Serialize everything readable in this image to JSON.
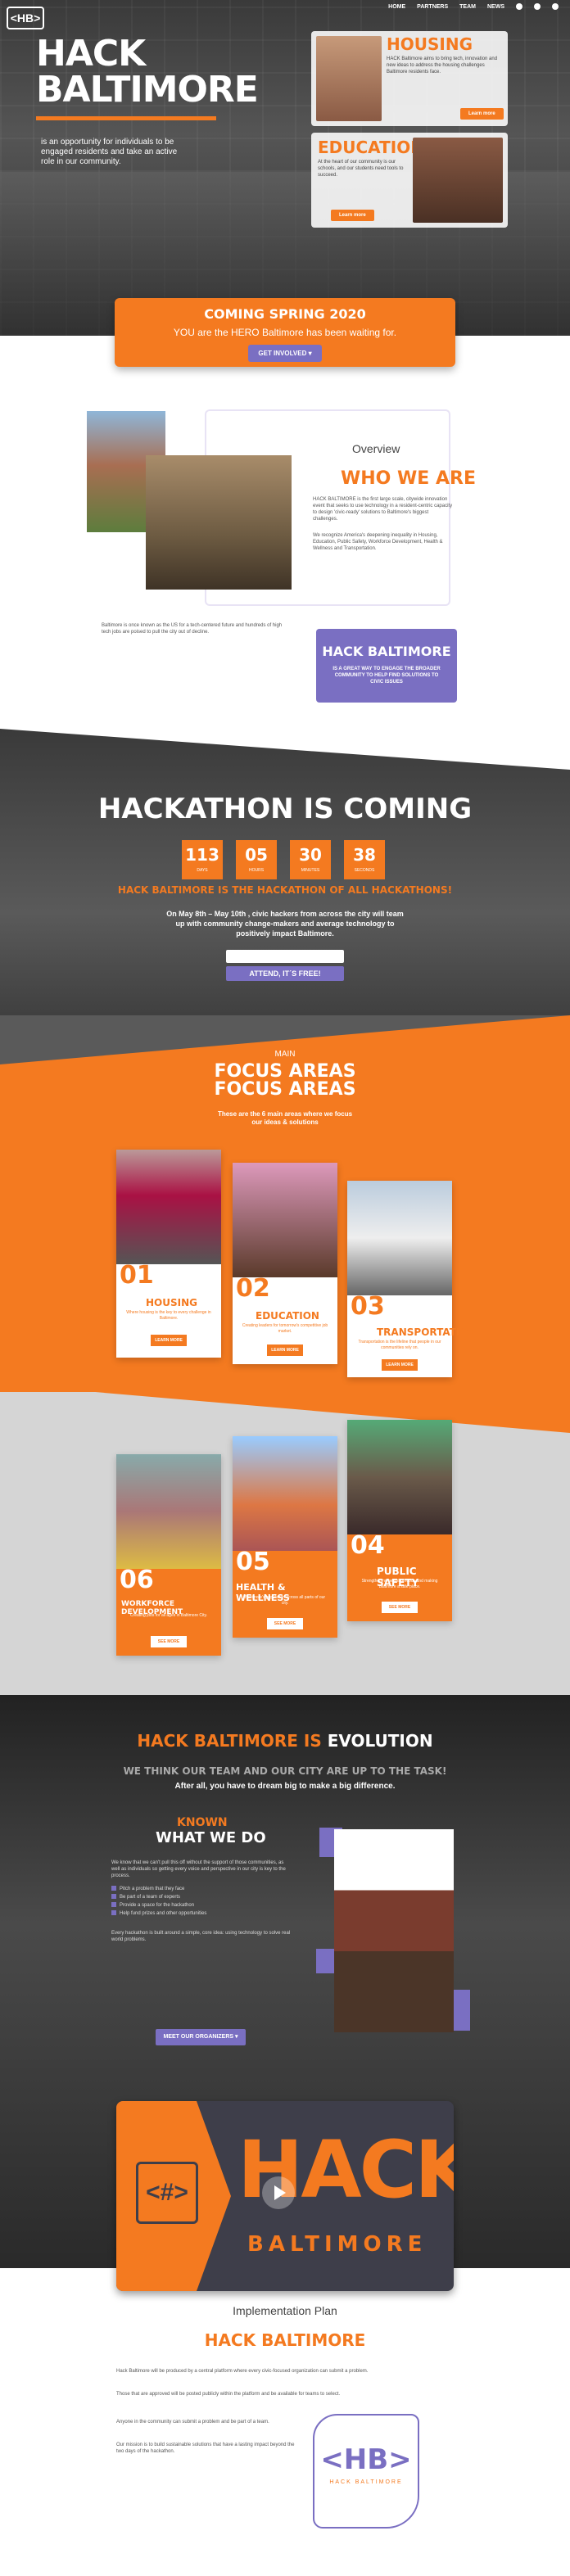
{
  "nav": {
    "logo": "<HB>",
    "items": [
      "HOME",
      "PARTNERS",
      "TEAM",
      "NEWS"
    ]
  },
  "hero": {
    "title1": "HACK",
    "title2": "BALTIMORE",
    "subtitle": "is an opportunity for individuals to be engaged residents and take an active role in our community."
  },
  "housing": {
    "title": "HOUSING",
    "text": "HACK Baltimore aims to bring tech, innovation and new ideas to address the housing challenges Baltimore residents face.",
    "btn": "Learn more"
  },
  "education": {
    "title": "EDUCATION",
    "text": "At the heart of our community is our schools, and our students need tools to succeed.",
    "btn": "Learn more"
  },
  "banner": {
    "title": "COMING SPRING 2020",
    "subtitle": "YOU are the HERO Baltimore has been waiting for.",
    "btn": "GET INVOLVED"
  },
  "overview": {
    "label": "Overview",
    "title": "WHO WE ARE",
    "p1": "HACK BALTIMORE is the first large scale, citywide innovation event that seeks to use technology in a resident-centric capacity to design 'civic-ready' solutions to Baltimore's biggest challenges.",
    "p2": "We recognize America's deepening inequality in Housing, Education, Public Safety, Workforce Development, Health & Wellness and Transportation.",
    "p3": "Baltimore is once known as the US for a tech-centered future and hundreds of high tech jobs are poised to pull the city out of decline.",
    "box_title": "HACK BALTIMORE",
    "box_text": "IS A GREAT WAY TO ENGAGE THE BROADER COMMUNITY TO HELP FIND SOLUTIONS TO CIVIC ISSUES"
  },
  "hackathon": {
    "title": "HACKATHON IS COMING",
    "countdown": [
      {
        "n": "113",
        "l": "days"
      },
      {
        "n": "05",
        "l": "hours"
      },
      {
        "n": "30",
        "l": "minutes"
      },
      {
        "n": "38",
        "l": "seconds"
      }
    ],
    "subtitle": "HACK BALTIMORE IS THE HACKATHON OF ALL HACKATHONS!",
    "desc": "On May 8th – May 10th , civic hackers from across the city will team up with community change-makers and average technology to positively impact Baltimore.",
    "btn": "ATTEND, IT´S FREE!"
  },
  "focus": {
    "label": "MAIN",
    "title1": "FOCUS AREAS",
    "title2": "FOCUS AREAS",
    "sub": "These are the 6 main areas where we focus our ideas & solutions",
    "cards": [
      {
        "num": "01",
        "name": "HOUSING",
        "desc": "Where housing is the key to every challenge in Baltimore.",
        "btn": "LEARN MORE"
      },
      {
        "num": "02",
        "name": "EDUCATION",
        "desc": "Creating leaders for tomorrow's competitive job market.",
        "btn": "LEARN MORE"
      },
      {
        "num": "03",
        "name": "TRANSPORTATION",
        "desc": "Transportation is the lifeline that people in our communities rely on.",
        "btn": "LEARN MORE"
      },
      {
        "num": "06",
        "name": "WORKFORCE DEVELOPMENT",
        "desc": "Creating jobs for all ages in Baltimore City.",
        "btn": "SEE MORE"
      },
      {
        "num": "05",
        "name": "HEALTH & WELLNESS",
        "desc": "Baltimore's population across all parts of our city.",
        "btn": "SEE MORE"
      },
      {
        "num": "04",
        "name": "PUBLIC SAFETY",
        "desc": "Strengthening neighborhoods and making Baltimore a safe place.",
        "btn": "SEE MORE"
      }
    ]
  },
  "evolution": {
    "title_o": "HACK BALTIMORE IS",
    "title_w": " EVOLUTION",
    "s1": "WE THINK OUR TEAM AND OUR CITY ARE UP TO THE TASK!",
    "s2": "After all, you have to dream big to make a big difference.",
    "known": "KNOWN",
    "wwd": "WHAT WE DO",
    "p": "We know that we can't pull this off without the support of those communities, as well as individuals so getting every voice and perspective in our city is key to the process.",
    "list": [
      "Pitch a problem that they face",
      "Be part of a team of experts",
      "Provide a space for the hackathon",
      "Help fund prizes and other opportunities"
    ],
    "p2": "Every hackathon is built around a simple, core idea: using technology to solve real world problems.",
    "btn": "MEET OUR ORGANIZERS"
  },
  "video": {
    "hb": "<#>",
    "big": "HACK",
    "small": "BALTIMORE"
  },
  "impl": {
    "label": "Implementation Plan",
    "title": "HACK BALTIMORE",
    "p1": "Hack Baltimore will be produced by a central platform where every civic-focused organization can submit a problem.",
    "p2": "Those that are approved will be posted publicly within the platform and be available for teams to select.",
    "p3": "Anyone in the community can submit a problem and be part of a team.",
    "p4": "Our mission is to build sustainable solutions that have a lasting impact beyond the two days of the hackathon.",
    "map_h": "<HB>",
    "map_s": "HACK BALTIMORE"
  }
}
